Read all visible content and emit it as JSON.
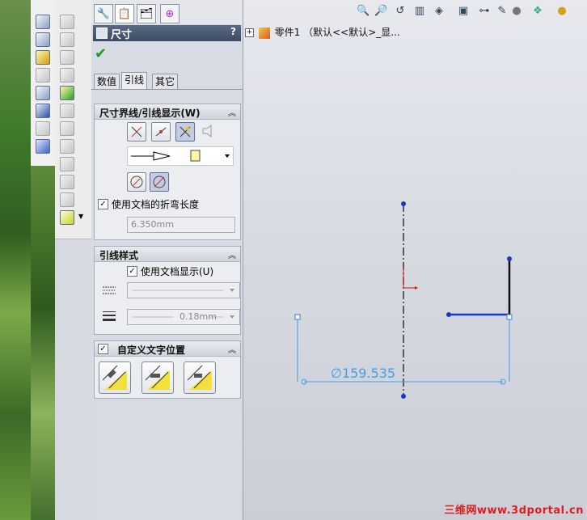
{
  "property_manager": {
    "title": "尺寸",
    "help": "?",
    "tabs": [
      "数值",
      "引线",
      "其它"
    ],
    "active_tab": "引线",
    "witness_section": {
      "title": "尺寸界线/引线显示(W)",
      "use_doc_bend_label": "使用文档的折弯长度",
      "bend_length": "6.350mm"
    },
    "leader_style_section": {
      "title": "引线样式",
      "use_doc_display_label": "使用文档显示(U)",
      "line_weight": "0.18mm"
    },
    "custom_text_section": {
      "title": "自定义文字位置"
    }
  },
  "tree": {
    "root_label": "零件1 （默认<<默认>_显..."
  },
  "sketch": {
    "dimension_text": "∅159.535",
    "dimension_value": 159.535
  },
  "watermark": "三维网www.3dportal.cn",
  "colors": {
    "header_bg": "#3d4b63",
    "dimension": "#3f9ee8",
    "sketch_line": "#1b35c9",
    "watermark": "#e21c1c"
  }
}
